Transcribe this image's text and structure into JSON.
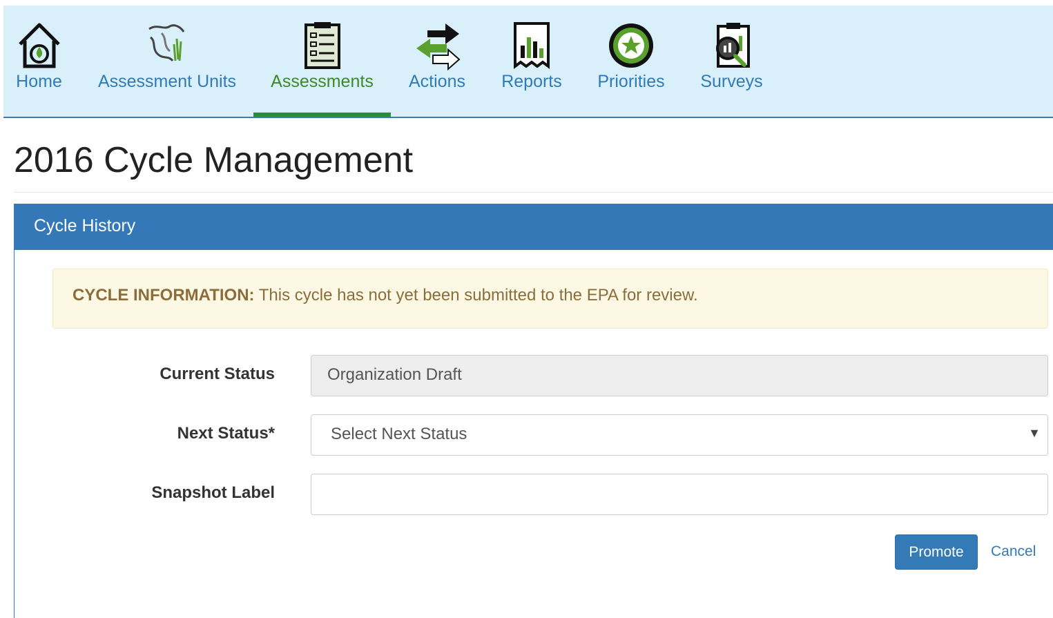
{
  "nav": {
    "items": [
      {
        "label": "Home",
        "icon": "home-icon"
      },
      {
        "label": "Assessment Units",
        "icon": "assessment-units-icon"
      },
      {
        "label": "Assessments",
        "icon": "assessments-icon",
        "active": true
      },
      {
        "label": "Actions",
        "icon": "actions-icon"
      },
      {
        "label": "Reports",
        "icon": "reports-icon"
      },
      {
        "label": "Priorities",
        "icon": "priorities-icon"
      },
      {
        "label": "Surveys",
        "icon": "surveys-icon"
      }
    ]
  },
  "page": {
    "title": "2016 Cycle Management"
  },
  "panel": {
    "title": "Cycle History",
    "alert": {
      "strong": "CYCLE INFORMATION:",
      "text": " This cycle has not yet been submitted to the EPA for review."
    },
    "form": {
      "current_status": {
        "label": "Current Status",
        "value": "Organization Draft"
      },
      "next_status": {
        "label": "Next Status*",
        "value": "Select Next Status"
      },
      "snapshot_label": {
        "label": "Snapshot Label",
        "value": ""
      }
    },
    "buttons": {
      "promote": "Promote",
      "cancel": "Cancel"
    }
  },
  "colors": {
    "nav_background": "#d9f0fb",
    "nav_link": "#2f7ab8",
    "nav_active": "#3b8a2a",
    "panel_header": "#3478b7",
    "alert_background": "#fcf8e3",
    "alert_text": "#8a6d3b",
    "primary_button": "#337ab7"
  }
}
